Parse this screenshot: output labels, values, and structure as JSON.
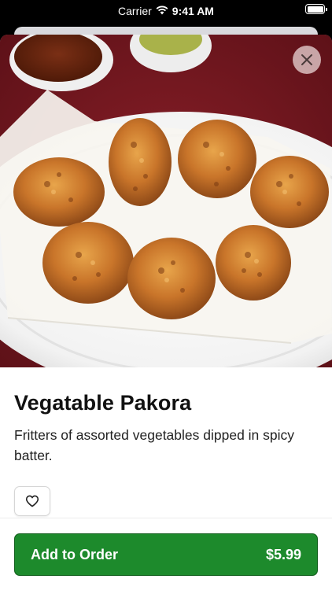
{
  "status_bar": {
    "carrier": "Carrier",
    "time": "9:41 AM"
  },
  "item": {
    "title": "Vegatable Pakora",
    "description": "Fritters of assorted vegetables dipped in spicy batter."
  },
  "actions": {
    "add_to_order_label": "Add to Order",
    "price": "$5.99"
  },
  "icons": {
    "close": "close-icon",
    "favorite": "heart-icon",
    "wifi": "wifi-icon",
    "battery": "battery-icon"
  },
  "colors": {
    "accent": "#1d8a2c",
    "hero_background": "#7d1a22"
  }
}
